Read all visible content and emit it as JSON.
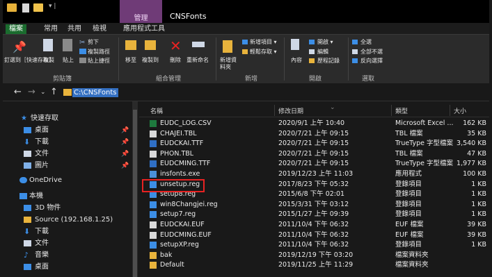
{
  "title_bar": {
    "context_label": "管理",
    "window_title": "CNSFonts",
    "context_color": "#6f3b77"
  },
  "tabs": [
    "檔案",
    "常用",
    "共用",
    "檢視",
    "應用程式工具"
  ],
  "ribbon": {
    "groups": [
      {
        "label": "剪貼簿",
        "items": [
          "釘選到［快速存取］",
          "複製",
          "貼上",
          "剪下",
          "複製路徑",
          "貼上捷徑"
        ]
      },
      {
        "label": "組合管理",
        "items": [
          "移至",
          "複製到",
          "刪除",
          "重新命名"
        ]
      },
      {
        "label": "新增",
        "items": [
          "新增資料夾",
          "新增項目 ▾",
          "輕鬆存取 ▾"
        ]
      },
      {
        "label": "開啟",
        "items": [
          "內容",
          "開啟 ▾",
          "編輯",
          "歷程記錄"
        ]
      },
      {
        "label": "選取",
        "items": [
          "全選",
          "全部不選",
          "反向選擇"
        ]
      }
    ]
  },
  "address": {
    "path": "C:\\CNSFonts"
  },
  "nav_pane": {
    "items": [
      {
        "label": "快速存取",
        "icon": "star-icon",
        "color": "#3c8ee6"
      },
      {
        "label": "桌面",
        "icon": "desktop-icon",
        "color": "#3c8ee6",
        "pinned": true
      },
      {
        "label": "下載",
        "icon": "download-icon",
        "color": "#3c8ee6",
        "pinned": true
      },
      {
        "label": "文件",
        "icon": "document-icon",
        "color": "#cfd8e6",
        "pinned": true
      },
      {
        "label": "圖片",
        "icon": "picture-icon",
        "color": "#7fb0e8",
        "pinned": true
      },
      {
        "label": "OneDrive",
        "icon": "cloud-icon",
        "color": "#3c8ee6"
      },
      {
        "label": "本機",
        "icon": "computer-icon",
        "color": "#3c8ee6"
      },
      {
        "label": "3D 物件",
        "icon": "cube-icon",
        "color": "#3c8ee6"
      },
      {
        "label": "Source (192.168.1.25)",
        "icon": "network-drive-icon",
        "color": "#e8b33c"
      },
      {
        "label": "下載",
        "icon": "download-icon",
        "color": "#3c8ee6"
      },
      {
        "label": "文件",
        "icon": "document-icon",
        "color": "#cfd8e6"
      },
      {
        "label": "音樂",
        "icon": "music-icon",
        "color": "#3c8ee6"
      },
      {
        "label": "桌面",
        "icon": "desktop-icon",
        "color": "#3c8ee6"
      }
    ]
  },
  "columns": {
    "name": "名稱",
    "modified": "修改日期",
    "type": "類型",
    "size": "大小"
  },
  "files": [
    {
      "name": "EUDC_LOG.CSV",
      "date": "2020/9/1 上午 10:40",
      "type": "Microsoft Excel ...",
      "size": "162 KB",
      "icon": "excel-icon"
    },
    {
      "name": "CHAJEI.TBL",
      "date": "2020/7/21 上午 09:15",
      "type": "TBL 檔案",
      "size": "35 KB",
      "icon": "file-icon"
    },
    {
      "name": "EUDCKAI.TTF",
      "date": "2020/7/21 上午 09:15",
      "type": "TrueType 字型檔案",
      "size": "3,540 KB",
      "icon": "font-icon"
    },
    {
      "name": "PHON.TBL",
      "date": "2020/7/21 上午 09:15",
      "type": "TBL 檔案",
      "size": "47 KB",
      "icon": "file-icon"
    },
    {
      "name": "EUDCMING.TTF",
      "date": "2020/7/21 上午 09:15",
      "type": "TrueType 字型檔案",
      "size": "1,977 KB",
      "icon": "font-icon"
    },
    {
      "name": "insfonts.exe",
      "date": "2019/12/23 上午 11:03",
      "type": "應用程式",
      "size": "100 KB",
      "icon": "exe-icon"
    },
    {
      "name": "unsetup.reg",
      "date": "2017/8/23 下午 05:32",
      "type": "登錄項目",
      "size": "1 KB",
      "icon": "registry-icon"
    },
    {
      "name": "setup8.reg",
      "date": "2015/6/8 下午 02:01",
      "type": "登錄項目",
      "size": "1 KB",
      "icon": "registry-icon"
    },
    {
      "name": "win8Changjei.reg",
      "date": "2015/3/31 下午 03:12",
      "type": "登錄項目",
      "size": "1 KB",
      "icon": "registry-icon"
    },
    {
      "name": "setup7.reg",
      "date": "2015/1/27 上午 09:39",
      "type": "登錄項目",
      "size": "1 KB",
      "icon": "registry-icon"
    },
    {
      "name": "EUDCKAI.EUF",
      "date": "2011/10/4 下午 06:32",
      "type": "EUF 檔案",
      "size": "39 KB",
      "icon": "file-icon"
    },
    {
      "name": "EUDCMING.EUF",
      "date": "2011/10/4 下午 06:32",
      "type": "EUF 檔案",
      "size": "39 KB",
      "icon": "file-icon"
    },
    {
      "name": "setupXP.reg",
      "date": "2011/10/4 下午 06:32",
      "type": "登錄項目",
      "size": "1 KB",
      "icon": "registry-icon"
    },
    {
      "name": "bak",
      "date": "2019/12/19 下午 03:20",
      "type": "檔案資料夾",
      "size": "",
      "icon": "folder-icon"
    },
    {
      "name": "Default",
      "date": "2019/11/25 上午 11:29",
      "type": "檔案資料夾",
      "size": "",
      "icon": "folder-icon"
    }
  ],
  "highlight_color": "#e82222"
}
